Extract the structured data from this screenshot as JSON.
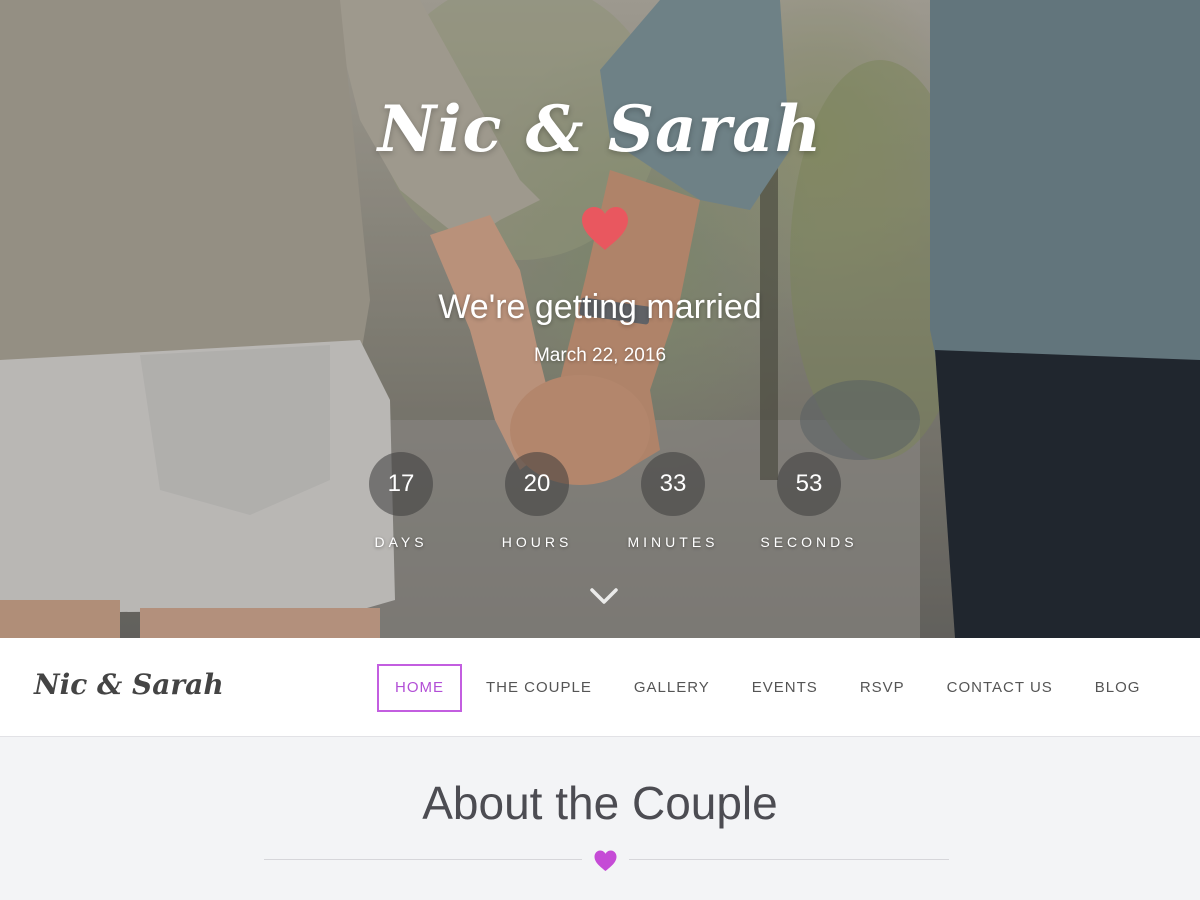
{
  "hero": {
    "title": "Nic & Sarah",
    "subtitle": "We're getting married",
    "date": "March 22, 2016",
    "heart_color": "#e9575f",
    "background_icon": "couple-holding-hands-photo",
    "scroll_icon": "chevron-down-icon",
    "countdown": [
      {
        "value": "17",
        "label": "DAYS"
      },
      {
        "value": "20",
        "label": "HOURS"
      },
      {
        "value": "33",
        "label": "MINUTES"
      },
      {
        "value": "53",
        "label": "SECONDS"
      }
    ]
  },
  "navbar": {
    "brand": "Nic & Sarah",
    "accent_color": "#c35ee0",
    "items": [
      {
        "label": "HOME",
        "active": true
      },
      {
        "label": "THE COUPLE",
        "active": false
      },
      {
        "label": "GALLERY",
        "active": false
      },
      {
        "label": "EVENTS",
        "active": false
      },
      {
        "label": "RSVP",
        "active": false
      },
      {
        "label": "CONTACT US",
        "active": false
      },
      {
        "label": "BLOG",
        "active": false
      }
    ]
  },
  "about": {
    "title": "About the Couple",
    "heart_color": "#c54bd6"
  }
}
